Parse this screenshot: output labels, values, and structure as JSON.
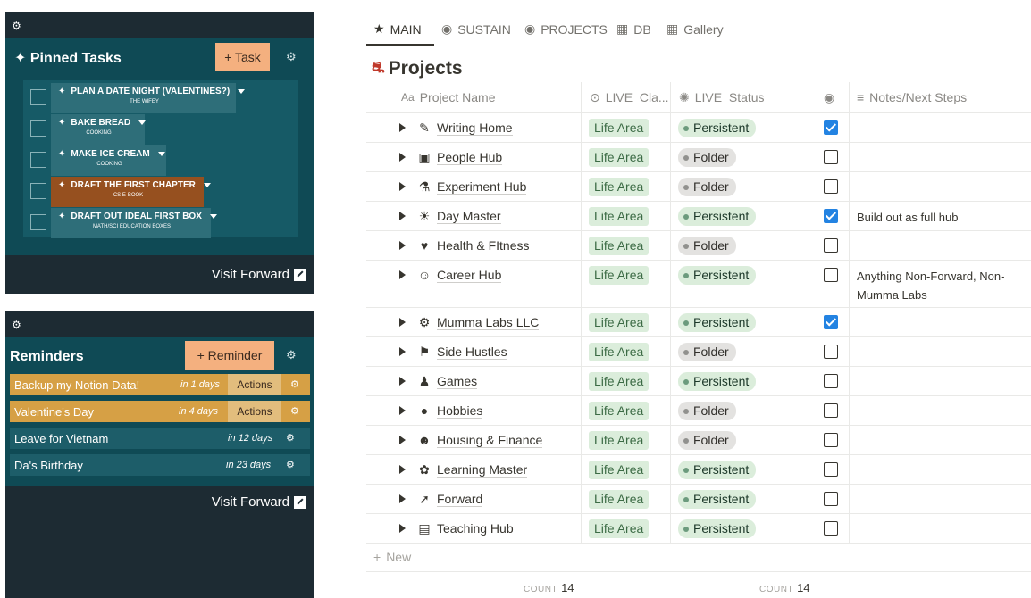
{
  "pinned_widget": {
    "title": "Pinned Tasks",
    "add_label": "+ Task",
    "tasks": [
      {
        "name": "PLAN A DATE NIGHT (VALENTINES?)",
        "sub": "THE WIFEY",
        "highlight": false
      },
      {
        "name": "BAKE BREAD",
        "sub": "COOKING",
        "highlight": false
      },
      {
        "name": "MAKE ICE CREAM",
        "sub": "COOKING",
        "highlight": false
      },
      {
        "name": "DRAFT THE FIRST CHAPTER",
        "sub": "CS E-BOOK",
        "highlight": true
      },
      {
        "name": "DRAFT OUT IDEAL FIRST BOX",
        "sub": "MATH/SCI EDUCATION BOXES",
        "highlight": false
      }
    ],
    "visit_label": "Visit Forward"
  },
  "reminders_widget": {
    "title": "Reminders",
    "add_label": "+ Reminder",
    "items": [
      {
        "text": "Backup my Notion Data!",
        "days": "in 1 days",
        "actions": "Actions",
        "style": "orange"
      },
      {
        "text": "Valentine's Day",
        "days": "in 4 days",
        "actions": "Actions",
        "style": "orange"
      },
      {
        "text": "Leave for Vietnam",
        "days": "in 12 days",
        "actions": "",
        "style": "teal"
      },
      {
        "text": "Da's Birthday",
        "days": "in 23 days",
        "actions": "",
        "style": "teal"
      }
    ],
    "visit_label": "Visit Forward"
  },
  "tabs": [
    {
      "label": "MAIN",
      "icon": "★",
      "active": true
    },
    {
      "label": "SUSTAIN",
      "icon": "◉",
      "active": false
    },
    {
      "label": "PROJECTS",
      "icon": "◉",
      "active": false
    },
    {
      "label": "DB",
      "icon": "▦",
      "active": false
    },
    {
      "label": "Gallery",
      "icon": "▦",
      "active": false
    }
  ],
  "page": {
    "title": "Projects",
    "title_icon": "⛐"
  },
  "columns": {
    "name": "Project Name",
    "class": "LIVE_Cla...",
    "status": "LIVE_Status",
    "notes": "Notes/Next Steps"
  },
  "rows": [
    {
      "icon": "✎",
      "name": "Writing Home",
      "area": "Life Area",
      "status": "Persistent",
      "color": "green",
      "checked": true,
      "notes": ""
    },
    {
      "icon": "▣",
      "name": "People Hub",
      "area": "Life Area",
      "status": "Folder",
      "color": "gray",
      "checked": false,
      "notes": ""
    },
    {
      "icon": "⚗",
      "name": "Experiment Hub",
      "area": "Life Area",
      "status": "Folder",
      "color": "gray",
      "checked": false,
      "notes": ""
    },
    {
      "icon": "☀",
      "name": "Day Master",
      "area": "Life Area",
      "status": "Persistent",
      "color": "green",
      "checked": true,
      "notes": "Build out as full hub"
    },
    {
      "icon": "♥",
      "name": "Health & FItness",
      "area": "Life Area",
      "status": "Folder",
      "color": "gray",
      "checked": false,
      "notes": ""
    },
    {
      "icon": "☺",
      "name": "Career Hub",
      "area": "Life Area",
      "status": "Persistent",
      "color": "green",
      "checked": false,
      "notes": "Anything Non-Forward, Non-Mumma Labs"
    },
    {
      "icon": "⚙",
      "name": "Mumma Labs LLC",
      "area": "Life Area",
      "status": "Persistent",
      "color": "green",
      "checked": true,
      "notes": ""
    },
    {
      "icon": "⚑",
      "name": "Side Hustles",
      "area": "Life Area",
      "status": "Folder",
      "color": "gray",
      "checked": false,
      "notes": ""
    },
    {
      "icon": "♟",
      "name": "Games",
      "area": "Life Area",
      "status": "Persistent",
      "color": "green",
      "checked": false,
      "notes": ""
    },
    {
      "icon": "●",
      "name": "Hobbies",
      "area": "Life Area",
      "status": "Folder",
      "color": "gray",
      "checked": false,
      "notes": ""
    },
    {
      "icon": "☻",
      "name": "Housing & Finance",
      "area": "Life Area",
      "status": "Folder",
      "color": "gray",
      "checked": false,
      "notes": ""
    },
    {
      "icon": "✿",
      "name": "Learning Master",
      "area": "Life Area",
      "status": "Persistent",
      "color": "green",
      "checked": false,
      "notes": ""
    },
    {
      "icon": "➚",
      "name": "Forward",
      "area": "Life Area",
      "status": "Persistent",
      "color": "green",
      "checked": false,
      "notes": ""
    },
    {
      "icon": "▤",
      "name": "Teaching Hub",
      "area": "Life Area",
      "status": "Persistent",
      "color": "green",
      "checked": false,
      "notes": ""
    }
  ],
  "new_label": "New",
  "counts": {
    "label": "COUNT",
    "name_count": "14",
    "status_count": "14"
  }
}
